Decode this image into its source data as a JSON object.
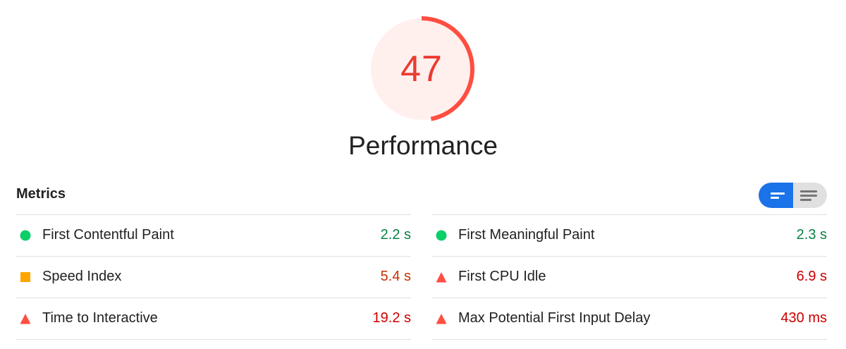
{
  "gauge": {
    "score": "47",
    "score_fraction": 0.47,
    "arc_color": "#ff4e42",
    "fill_color": "#fff0ee",
    "text_color": "#eb3b2f"
  },
  "category": {
    "title": "Performance"
  },
  "metrics": {
    "heading": "Metrics",
    "toggle": {
      "active_icon": "summary-view-icon",
      "inactive_icon": "list-view-icon",
      "active_color": "#1a73e8"
    },
    "left": [
      {
        "label": "First Contentful Paint",
        "value": "2.2 s",
        "status": "pass",
        "icon": "green-circle-icon"
      },
      {
        "label": "Speed Index",
        "value": "5.4 s",
        "status": "average",
        "icon": "orange-square-icon"
      },
      {
        "label": "Time to Interactive",
        "value": "19.2 s",
        "status": "fail",
        "icon": "red-triangle-icon"
      }
    ],
    "right": [
      {
        "label": "First Meaningful Paint",
        "value": "2.3 s",
        "status": "pass",
        "icon": "green-circle-icon"
      },
      {
        "label": "First CPU Idle",
        "value": "6.9 s",
        "status": "fail",
        "icon": "red-triangle-icon"
      },
      {
        "label": "Max Potential First Input Delay",
        "value": "430 ms",
        "status": "fail",
        "icon": "red-triangle-icon"
      }
    ]
  },
  "status_colors": {
    "pass": "#0cce6b",
    "average": "#ffa400",
    "fail": "#ff4e42"
  }
}
